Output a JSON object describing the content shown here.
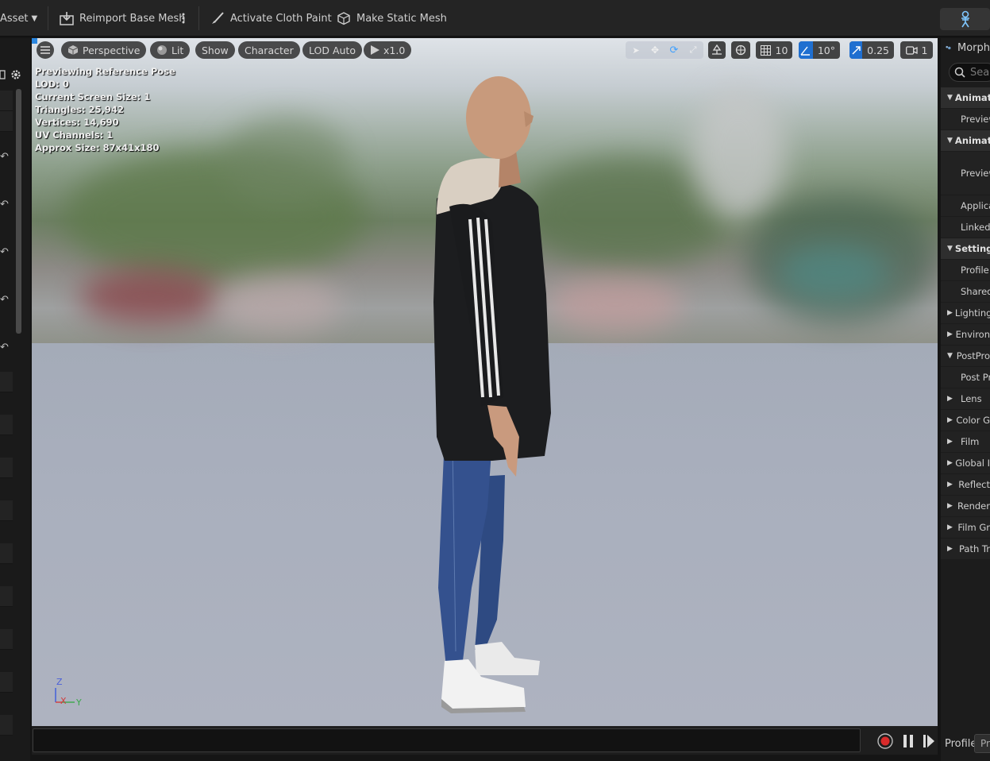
{
  "toolbar": {
    "asset_menu": "Asset",
    "reimport": "Reimport Base Mesh",
    "cloth_paint": "Activate Cloth Paint",
    "static_mesh": "Make Static Mesh"
  },
  "viewport": {
    "buttons": {
      "perspective": "Perspective",
      "lit": "Lit",
      "show": "Show",
      "character": "Character",
      "lod": "LOD Auto",
      "speed": "x1.0"
    },
    "right_tools": {
      "grid_snap": "10",
      "rotation_snap": "10°",
      "scale_snap": "0.25",
      "camera_speed": "1"
    },
    "stats": [
      "Previewing Reference Pose",
      "LOD: 0",
      "Current Screen Size: 1",
      "Triangles: 25,942",
      "Vertices: 14,690",
      "UV Channels: 1",
      "Approx Size: 87x41x180"
    ],
    "axis": {
      "z": "Z",
      "x": "X",
      "y": "Y"
    }
  },
  "right_panel": {
    "title": "Morph",
    "search_placeholder": "Sea",
    "rows": [
      {
        "type": "header",
        "label": "Animati",
        "expanded": true
      },
      {
        "type": "item",
        "label": "Preview"
      },
      {
        "type": "header",
        "label": "Animati",
        "expanded": true
      },
      {
        "type": "item",
        "label": "Preview"
      },
      {
        "type": "item",
        "label": "Applica"
      },
      {
        "type": "item",
        "label": "Linked A"
      },
      {
        "type": "header",
        "label": "Setting",
        "expanded": true
      },
      {
        "type": "item",
        "label": "Profile N"
      },
      {
        "type": "item",
        "label": "Shared"
      },
      {
        "type": "group",
        "label": "Lighting",
        "expanded": false
      },
      {
        "type": "group",
        "label": "Environ",
        "expanded": false
      },
      {
        "type": "group",
        "label": "PostPro",
        "expanded": true
      },
      {
        "type": "item",
        "label": "Post Pr"
      },
      {
        "type": "group",
        "label": "Lens",
        "expanded": false
      },
      {
        "type": "group",
        "label": "Color G",
        "expanded": false
      },
      {
        "type": "group",
        "label": "Film",
        "expanded": false
      },
      {
        "type": "group",
        "label": "Global I",
        "expanded": false
      },
      {
        "type": "group",
        "label": "Reflect",
        "expanded": false
      },
      {
        "type": "group",
        "label": "Render",
        "expanded": false
      },
      {
        "type": "group",
        "label": "Film Gr",
        "expanded": false
      },
      {
        "type": "group",
        "label": "Path Tr",
        "expanded": false
      }
    ],
    "profile_label": "Profile",
    "profile_value": "Pr"
  },
  "colors": {
    "accent": "#1f6fd0",
    "record": "#d92b2b"
  }
}
